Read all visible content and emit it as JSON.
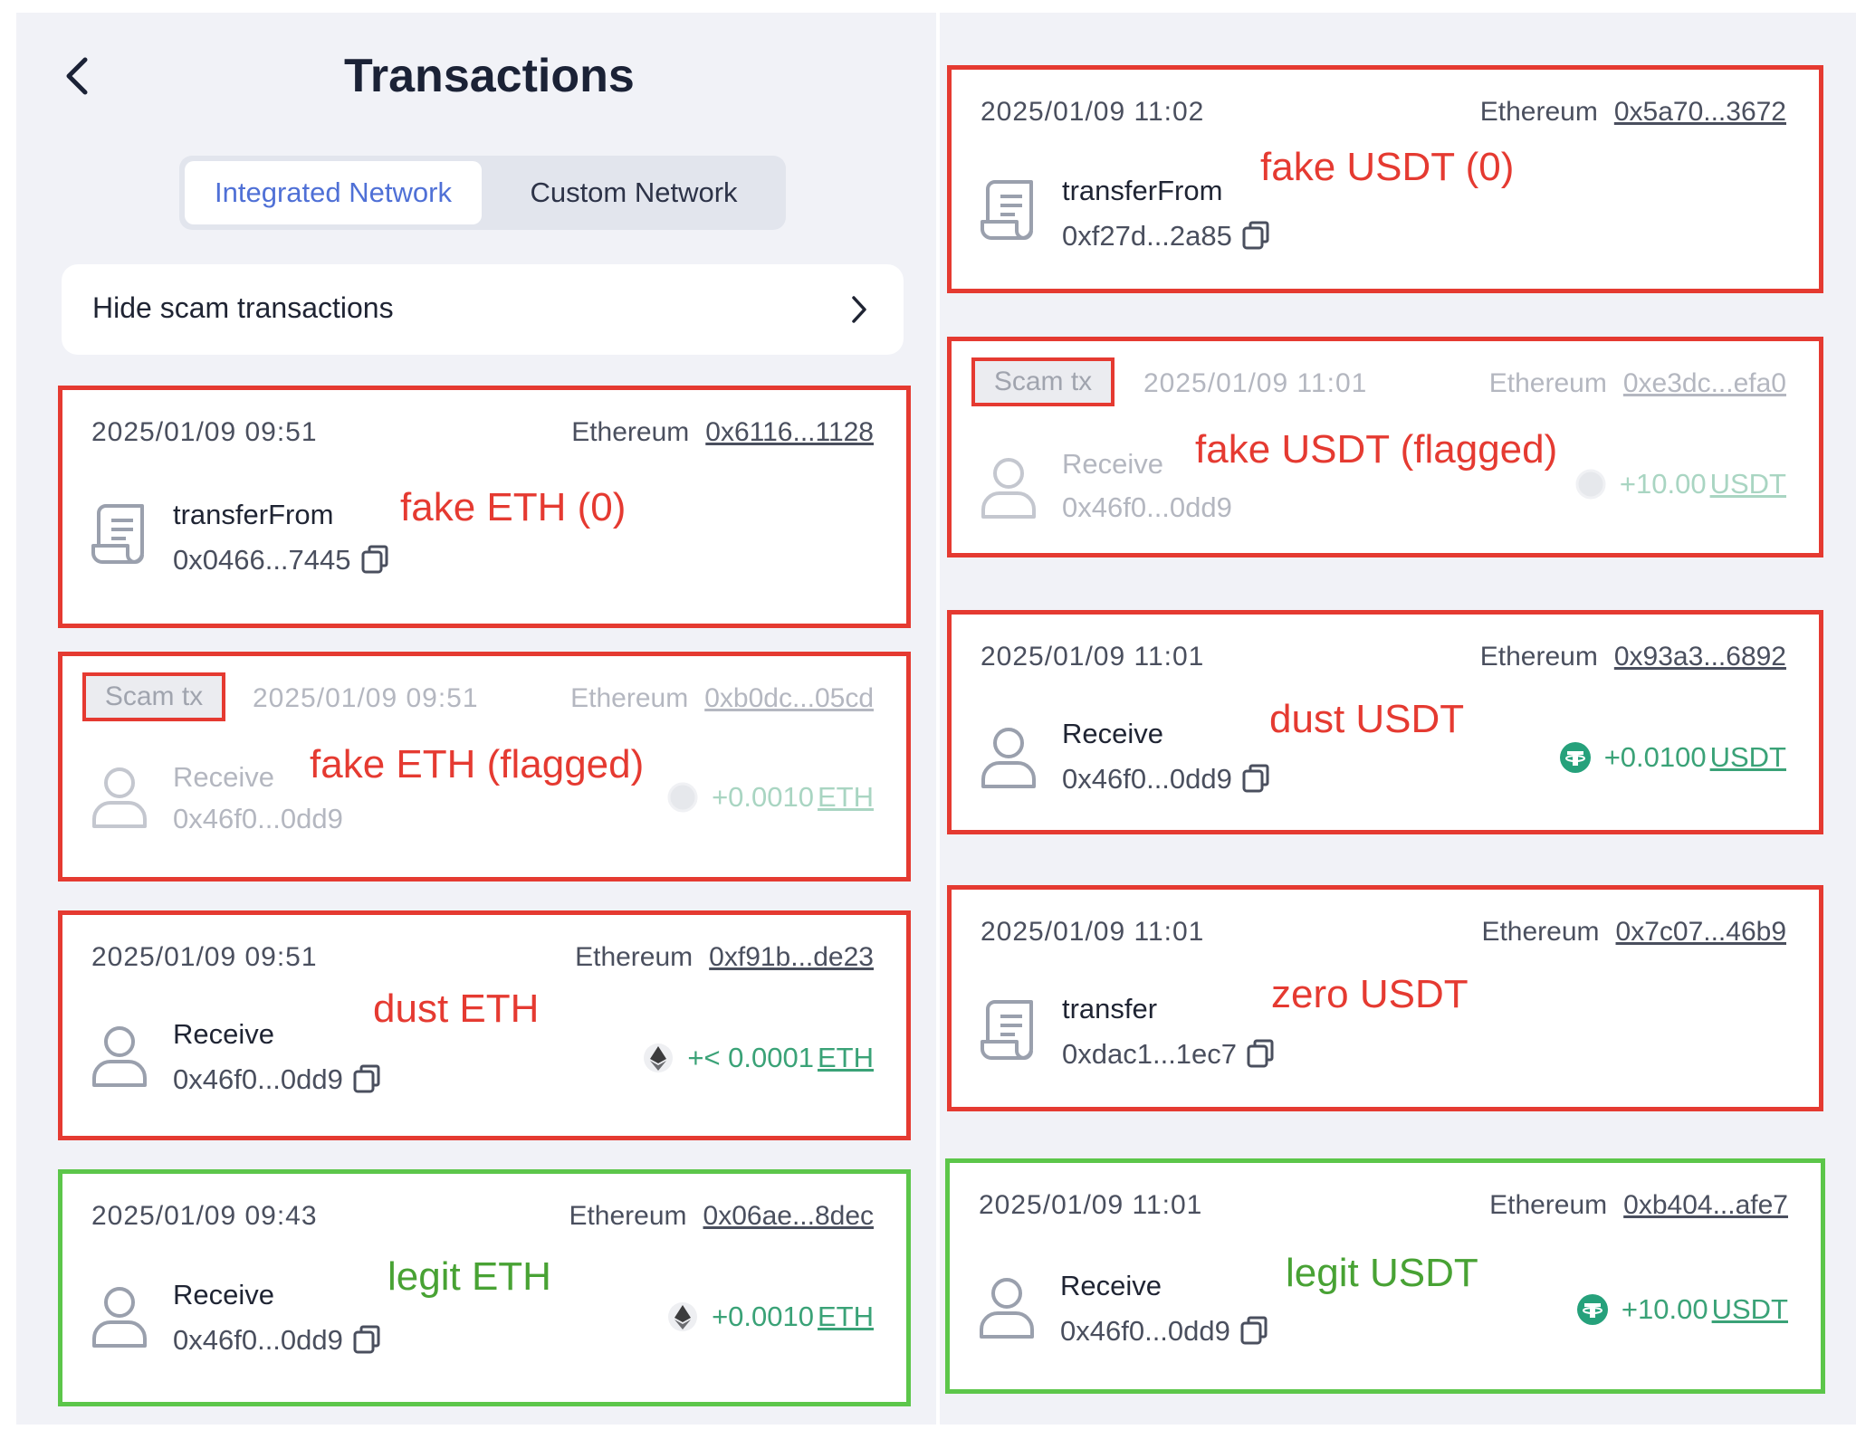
{
  "header": {
    "title": "Transactions"
  },
  "tabs": [
    {
      "label": "Integrated Network",
      "active": true
    },
    {
      "label": "Custom Network",
      "active": false
    }
  ],
  "hide_scam": {
    "label": "Hide scam transactions"
  },
  "colors": {
    "flag_red": "#e53a31",
    "legit_green": "#5cc64a",
    "accent_blue": "#4f70d6",
    "amount_green": "#3aa277"
  },
  "left_cards": [
    {
      "date": "2025/01/09 09:51",
      "network": "Ethereum",
      "hash": "0x6116...1128",
      "method": "transferFrom",
      "address": "0x0466...7445",
      "amount": "",
      "unit": "",
      "icon": "contract-icon",
      "note": "fake ETH (0)"
    },
    {
      "badge": "Scam tx",
      "date": "2025/01/09 09:51",
      "network": "Ethereum",
      "hash": "0xb0dc...05cd",
      "method": "Receive",
      "address": "0x46f0...0dd9",
      "amount": "+0.0010",
      "unit": "ETH",
      "icon": "user-icon",
      "note": "fake ETH (flagged)"
    },
    {
      "date": "2025/01/09 09:51",
      "network": "Ethereum",
      "hash": "0xf91b...de23",
      "method": "Receive",
      "address": "0x46f0...0dd9",
      "amount": "+< 0.0001",
      "unit": "ETH",
      "icon": "user-icon",
      "note": "dust ETH"
    },
    {
      "date": "2025/01/09 09:43",
      "network": "Ethereum",
      "hash": "0x06ae...8dec",
      "method": "Receive",
      "address": "0x46f0...0dd9",
      "amount": "+0.0010",
      "unit": "ETH",
      "icon": "user-icon",
      "note": "legit ETH"
    }
  ],
  "right_cards": [
    {
      "date": "2025/01/09 11:02",
      "network": "Ethereum",
      "hash": "0x5a70...3672",
      "method": "transferFrom",
      "address": "0xf27d...2a85",
      "amount": "",
      "unit": "",
      "icon": "contract-icon",
      "note": "fake USDT (0)"
    },
    {
      "badge": "Scam tx",
      "date": "2025/01/09 11:01",
      "network": "Ethereum",
      "hash": "0xe3dc...efa0",
      "method": "Receive",
      "address": "0x46f0...0dd9",
      "amount": "+10.00",
      "unit": "USDT",
      "icon": "user-icon",
      "note": "fake USDT (flagged)"
    },
    {
      "date": "2025/01/09 11:01",
      "network": "Ethereum",
      "hash": "0x93a3...6892",
      "method": "Receive",
      "address": "0x46f0...0dd9",
      "amount": "+0.0100",
      "unit": "USDT",
      "icon": "user-icon",
      "note": "dust USDT"
    },
    {
      "date": "2025/01/09 11:01",
      "network": "Ethereum",
      "hash": "0x7c07...46b9",
      "method": "transfer",
      "address": "0xdac1...1ec7",
      "amount": "",
      "unit": "",
      "icon": "contract-icon",
      "note": "zero USDT"
    },
    {
      "date": "2025/01/09 11:01",
      "network": "Ethereum",
      "hash": "0xb404...afe7",
      "method": "Receive",
      "address": "0x46f0...0dd9",
      "amount": "+10.00",
      "unit": "USDT",
      "icon": "user-icon",
      "note": "legit USDT"
    }
  ]
}
